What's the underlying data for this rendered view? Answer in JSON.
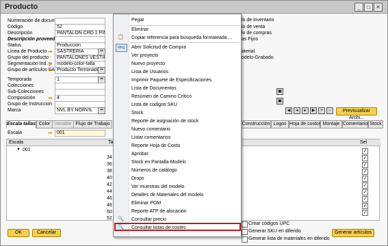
{
  "window": {
    "title": "Producto"
  },
  "form": {
    "labels": [
      "Numeración de documento",
      "Código",
      "Descripción",
      "Descripción proveedor",
      "Status",
      "Línea de Producto",
      "Grupo del producto",
      "Segmentación Ind. y",
      "Grupo de artículos SAP"
    ],
    "values": [
      "",
      "52",
      "PANTALÓN CRD 1 PINZA",
      "",
      "Producción",
      "SASTRERIA",
      "PANTALONES VESTIR",
      "modelo-color-talla",
      "Producto Terminado"
    ],
    "labels2": [
      "Temporada",
      "Colecciones",
      "Sub-Colecciones",
      "Composición",
      "Grupo de Instruccion",
      "Marca"
    ],
    "values2": [
      "1",
      "",
      "",
      "4",
      "",
      "NVL BY NORVIL"
    ]
  },
  "right_panel": {
    "items": [
      "lo de inventario",
      "lo de venta",
      "lo de compras",
      "as Fijos",
      "aterial",
      "odelo-Grabado"
    ],
    "preview_button": "Previsualizar Archi..."
  },
  "tabs": [
    "Escala tallas",
    "Color",
    "Variable",
    "Flujo de Trabajo",
    "Construcción",
    "Logos",
    "Hoja de costos",
    "Montaje",
    "Comentarios",
    "Stock"
  ],
  "scale": {
    "label": "Escala",
    "value": "001"
  },
  "grid": {
    "header_col1": "Escala",
    "header_col2": "Tall",
    "header_sel": "Sel",
    "row_label": "001",
    "numbers": [
      "34",
      "36",
      "38",
      "40",
      "42",
      "44",
      "46",
      "48",
      "50",
      "52"
    ]
  },
  "bottom": {
    "ok": "OK",
    "cancel": "Cancelar",
    "check1": "Crear códigos UPC",
    "check2": "Generar SKU en diferido",
    "check3": "Generar lista de materiales en diferido",
    "generate": "Generar artículos"
  },
  "context_menu": {
    "items": [
      "Pegar",
      "Eliminar",
      "Copiar referencia para busqueda formateada ...",
      "Abrir Solicitud de Compra",
      "Ver proyecto",
      "Nuevo proyecto",
      "Lista de Usuarios",
      "Imprimir Paquete de Especificaciones",
      "Lista de Documentos",
      "Resúmen de Camino Crítico",
      "Lista de codigos SKU",
      "Stock",
      "Reporte de asignación de stock",
      "Nuevo comentario",
      "Listar comentarios",
      "Reporte Hoja de Costo",
      "Aprobar",
      "Stock en Pantalla-Modelo",
      "Números de catálogo",
      "Drops",
      "Ver muestras del modelo",
      "Detalles de Materiales del modelo",
      "Eliminar POM",
      "Reporte ATP de alocación",
      "Consultar precio",
      "Consultar listas de costes"
    ],
    "rfq_icon_text": "RFQ",
    "highlighted_item": "Consultar listas de costes",
    "highlight_color": "#c0181c"
  }
}
